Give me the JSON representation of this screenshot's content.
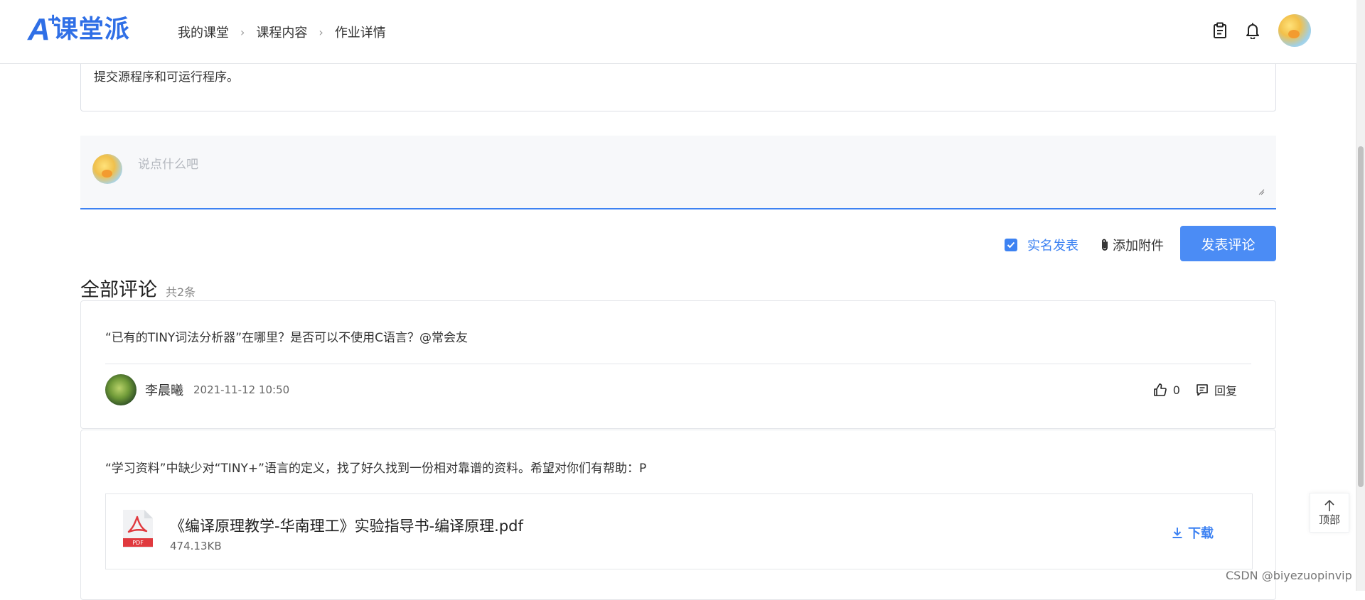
{
  "header": {
    "logo_text": "课堂派",
    "breadcrumb": [
      "我的课堂",
      "课程内容",
      "作业详情"
    ],
    "icons": [
      "clipboard-icon",
      "bell-icon"
    ]
  },
  "assignment": {
    "description": "提交源程序和可运行程序。"
  },
  "editor": {
    "placeholder": "说点什么吧"
  },
  "post_bar": {
    "realname_label": "实名发表",
    "realname_checked": true,
    "attach_label": "添加附件",
    "post_label": "发表评论"
  },
  "comments_section": {
    "title": "全部评论",
    "count": "共2条"
  },
  "comments": [
    {
      "text": "“已有的TINY词法分析器”在哪里？是否可以不使用C语言？@常会友",
      "user": "李晨曦",
      "time": "2021-11-12 10:50",
      "likes": "0",
      "reply_label": "回复"
    },
    {
      "text": "“学习资料”中缺少对“TINY+”语言的定义，找了好久找到一份相对靠谱的资料。希望对你们有帮助：P",
      "attachment": {
        "icon_label": "PDF",
        "name": "《编译原理教学-华南理工》实验指导书-编译原理.pdf",
        "size": "474.13KB",
        "download_label": "下载"
      }
    }
  ],
  "floating": {
    "top_label": "顶部"
  },
  "watermark": "CSDN @biyezuopinvip",
  "colors": {
    "accent": "#3d82f2",
    "brand": "#2f6fe6",
    "pdf_red": "#e0393e"
  }
}
